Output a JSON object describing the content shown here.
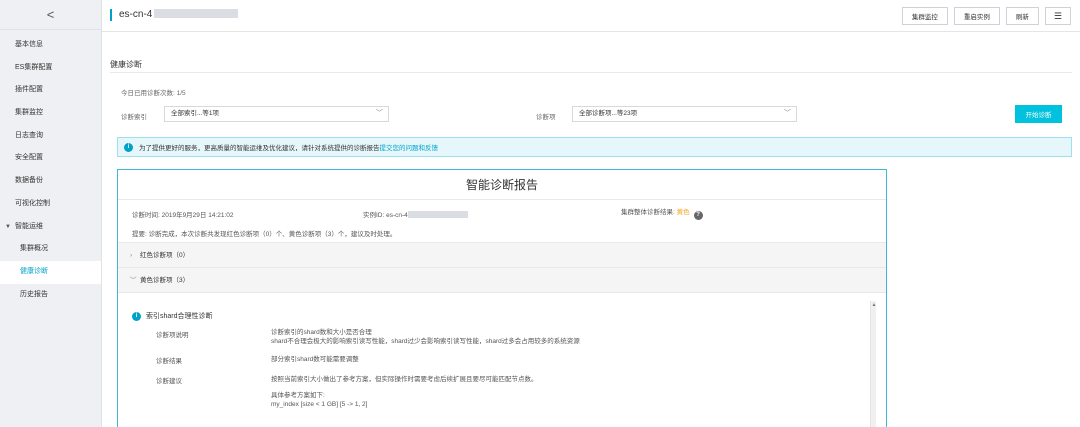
{
  "sidebar": {
    "back_glyph": "<",
    "items": [
      {
        "label": "基本信息"
      },
      {
        "label": "ES集群配置"
      },
      {
        "label": "插件配置"
      },
      {
        "label": "集群监控"
      },
      {
        "label": "日志查询"
      },
      {
        "label": "安全配置"
      },
      {
        "label": "数据备份"
      },
      {
        "label": "可视化控制"
      }
    ],
    "group": {
      "label": "智能运维",
      "caret": "▼"
    },
    "sub_items": [
      {
        "label": "集群概况"
      },
      {
        "label": "健康诊断"
      },
      {
        "label": "历史报告"
      }
    ]
  },
  "header": {
    "cluster_prefix": "es-cn-4",
    "buttons": {
      "monitor": "集群监控",
      "restart": "重启实例",
      "refresh": "刷新",
      "menu": "☰"
    }
  },
  "main": {
    "section_title": "健康诊断",
    "quota": "今日已用诊断次数: 1/5",
    "index_label": "诊断索引",
    "index_value": "全部索引...等1项",
    "item_label": "诊断项",
    "item_value": "全部诊断项...等23项",
    "diagnose_button": "开始诊断",
    "notice_text": "为了提供更好的服务，更高质量的智能运维及优化建议，请针对系统提供的诊断报告",
    "notice_link": "提交您的问题和反馈"
  },
  "report": {
    "title": "智能诊断报告",
    "time_label": "诊断时间: 2019年9月29日 14:21:02",
    "instance_label": "实例ID: es-cn-4",
    "result_label": "集群整体诊断结果:",
    "result_value": "黄色",
    "summary": "提要: 诊断完成，本次诊断共发现红色诊断项（0）个、黄色诊断项（3）个，建议及时处理。",
    "red_section": "红色诊断项（0）",
    "yellow_section": "黄色诊断项（3）",
    "item": {
      "title": "索引shard合理性诊断",
      "desc_key": "诊断项说明",
      "desc_line1": "诊断索引的shard数和大小是否合理",
      "desc_line2": "shard不合理会极大的影响索引读写性能，shard过少会影响索引读写性能，shard过多会占用较多的系统资源",
      "result_key": "诊断结果",
      "result_val": "部分索引shard数可能需要调整",
      "advice_key": "诊断建议",
      "advice_val": "按照当前索引大小做出了参考方案，但实际操作时需要考虑后续扩展且要尽可能匹配节点数。",
      "plan_title": "具体参考方案如下:",
      "plan_line": "my_index [size < 1 GB] [5 -> 1, 2]"
    }
  }
}
